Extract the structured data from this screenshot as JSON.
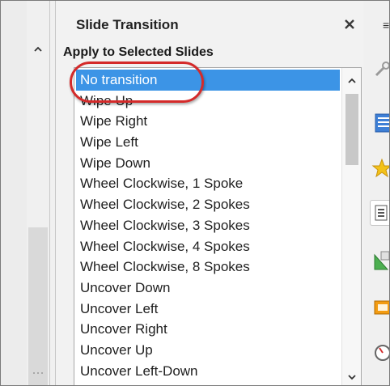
{
  "panel": {
    "title": "Slide Transition",
    "close_glyph": "✕",
    "section_label": "Apply to Selected Slides"
  },
  "transitions": {
    "selected_index": 0,
    "items": [
      "No transition",
      "Wipe Up",
      "Wipe Right",
      "Wipe Left",
      "Wipe Down",
      "Wheel Clockwise, 1 Spoke",
      "Wheel Clockwise, 2 Spokes",
      "Wheel Clockwise, 3 Spokes",
      "Wheel Clockwise, 4 Spokes",
      "Wheel Clockwise, 8 Spokes",
      "Uncover Down",
      "Uncover Left",
      "Uncover Right",
      "Uncover Up",
      "Uncover Left-Down"
    ]
  },
  "sidebar_deck": {
    "menu_glyph": "≡",
    "icons": [
      "wrench-icon",
      "properties-icon",
      "gallery-star-icon",
      "slide-transition-icon",
      "animation-icon",
      "master-slides-icon",
      "navigator-icon"
    ]
  },
  "colors": {
    "selection": "#3c94e6",
    "highlight_ring": "#d42a2a"
  }
}
